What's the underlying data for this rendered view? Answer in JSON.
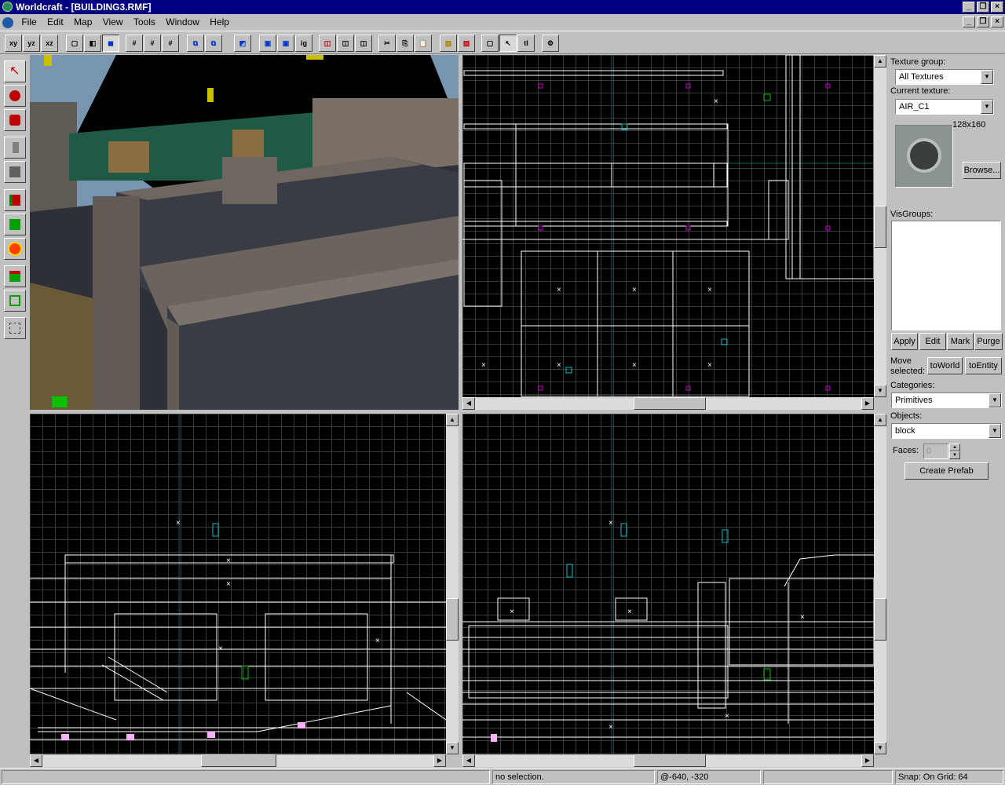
{
  "window": {
    "title": "Worldcraft - [BUILDING3.RMF]"
  },
  "menu": {
    "items": [
      "File",
      "Edit",
      "Map",
      "View",
      "Tools",
      "Window",
      "Help"
    ]
  },
  "toolbar": {
    "view_labels": [
      "xy",
      "yz",
      "xz"
    ],
    "ig_label": "ig"
  },
  "texture_panel": {
    "group_label": "Texture group:",
    "group_value": "All Textures",
    "current_label": "Current texture:",
    "current_value": "AIR_C1",
    "size_text": "128x160",
    "browse_label": "Browse..."
  },
  "visgroups": {
    "label": "VisGroups:",
    "buttons": [
      "Apply",
      "Edit",
      "Mark",
      "Purge"
    ]
  },
  "move_selected": {
    "label_line1": "Move",
    "label_line2": "selected:",
    "to_world": "toWorld",
    "to_entity": "toEntity"
  },
  "categories": {
    "label": "Categories:",
    "value": "Primitives"
  },
  "objects": {
    "label": "Objects:",
    "value": "block",
    "faces_label": "Faces:",
    "faces_value": "0",
    "create_prefab": "Create Prefab"
  },
  "status": {
    "selection": "no selection.",
    "coords": "@-640, -320",
    "snap": "Snap: On Grid: 64"
  }
}
